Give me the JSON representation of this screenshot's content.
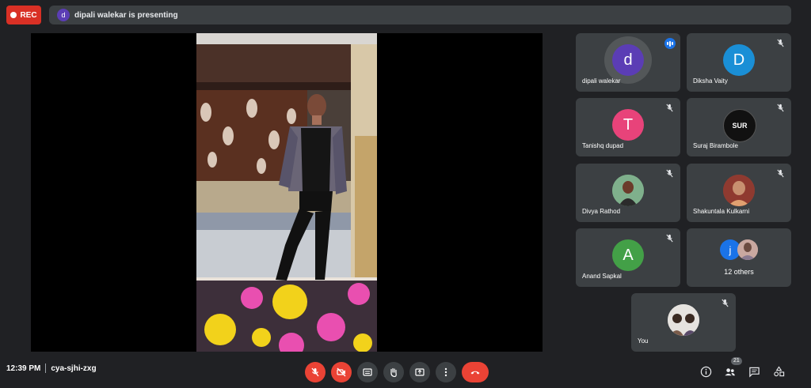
{
  "rec_label": "REC",
  "presenting": {
    "initial": "d",
    "text": "dipali walekar is presenting"
  },
  "tiles": [
    {
      "name": "dipali walekar",
      "initial": "d",
      "color": "#5b3db5"
    },
    {
      "name": "Diksha Vaity",
      "initial": "D",
      "color": "#1a8fd6"
    },
    {
      "name": "Tanishq dupad",
      "initial": "T",
      "color": "#e8437a"
    },
    {
      "name": "Suraj Birambole",
      "initial": "SUR",
      "color": "#111111"
    },
    {
      "name": "Divya Rathod"
    },
    {
      "name": "Shakuntala Kulkarni"
    },
    {
      "name": "Anand Sapkal",
      "initial": "A",
      "color": "#43a047"
    },
    {
      "initial": "j",
      "label": "12 others"
    },
    {
      "name": "You"
    }
  ],
  "meeting": {
    "time": "12:39 PM",
    "code": "cya-sjhi-zxg"
  },
  "participants_count": "21",
  "controls": [
    "mic-off",
    "camera-off",
    "captions",
    "raise-hand",
    "present",
    "more-options",
    "leave-call"
  ],
  "colors": {
    "background": "#202124",
    "tile": "#3c4043",
    "danger": "#ea4335",
    "rec": "#d93025"
  }
}
